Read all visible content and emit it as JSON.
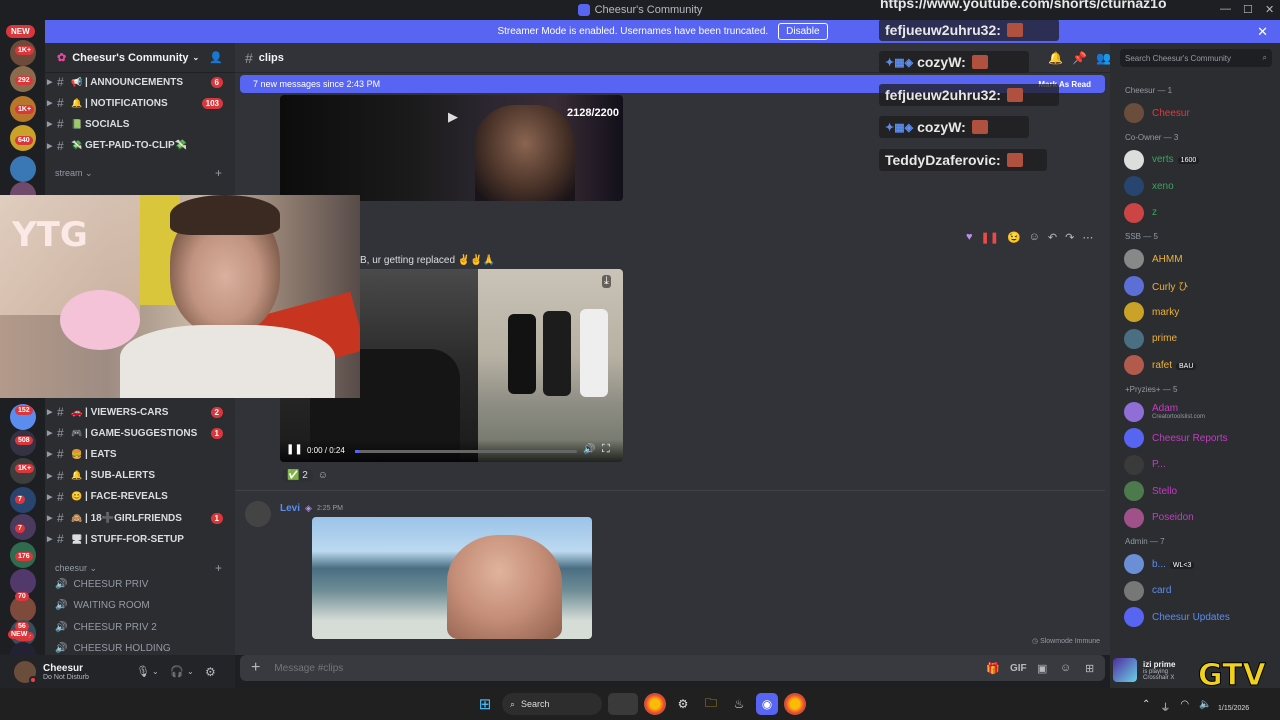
{
  "window": {
    "title": "Cheesur's Community"
  },
  "banner": {
    "text": "Streamer Mode is enabled. Usernames have been truncated.",
    "disable_label": "Disable"
  },
  "rail": {
    "new_label": "NEW",
    "badges": [
      "1K+",
      "292",
      "1K+",
      "640",
      "152",
      "508",
      "1K+",
      "7",
      "7",
      "176",
      "70",
      "56",
      "1K+"
    ]
  },
  "server": {
    "name": "Cheesur's Community"
  },
  "channels_top": [
    {
      "emoji": "📢",
      "name": "| ANNOUNCEMENTS",
      "count": "6"
    },
    {
      "emoji": "🔔",
      "name": "| NOTIFICATIONS",
      "count": "103"
    },
    {
      "emoji": "📗",
      "name": "SOCIALS",
      "count": ""
    },
    {
      "emoji": "💸",
      "name": "GET-PAID-TO-CLIP💸",
      "count": ""
    }
  ],
  "category_stream": "stream",
  "channels_bottom": [
    {
      "emoji": "🚗",
      "name": "| VIEWERS-CARS",
      "count": "2"
    },
    {
      "emoji": "🎮",
      "name": "| GAME-SUGGESTIONS",
      "count": "1"
    },
    {
      "emoji": "🍔",
      "name": "| EATS",
      "count": ""
    },
    {
      "emoji": "🔔",
      "name": "| SUB-ALERTS",
      "count": ""
    },
    {
      "emoji": "😊",
      "name": "| FACE-REVEALS",
      "count": ""
    },
    {
      "emoji": "🙈",
      "name": "| 18➕GIRLFRIENDS",
      "count": "1"
    },
    {
      "emoji": "🖥",
      "name": "| STUFF-FOR-SETUP",
      "count": ""
    }
  ],
  "category_cheesur": "cheesur",
  "voice_channels": [
    "CHEESUR PRIV",
    "WAITING ROOM",
    "CHEESUR PRIV 2",
    "CHEESUR HOLDING"
  ],
  "user": {
    "name": "Cheesur",
    "status": "Do Not Disturb"
  },
  "channel": {
    "name": "clips"
  },
  "new_messages": {
    "text": "7 new messages since 2:43 PM",
    "mark": "Mark As Read"
  },
  "messages": {
    "video1_counter": "2128/2200",
    "msg2_text": "B, ur getting replaced ✌✌🙏",
    "video2_time": "0:00 / 0:24",
    "reaction_count": "2",
    "msg3_author": "Levi",
    "msg3_time": "2:25 PM"
  },
  "composer": {
    "placeholder": "Message #clips",
    "slowmode": "Slowmode Immune"
  },
  "members": {
    "search_placeholder": "Search Cheesur's Community",
    "groups": [
      {
        "title": "Cheesur — 1",
        "people": [
          {
            "name": "Cheesur",
            "color": "#e03a3e",
            "sub": ""
          }
        ]
      },
      {
        "title": "Co-Owner — 3",
        "people": [
          {
            "name": "verts",
            "color": "#3ba55c",
            "sub": "",
            "tag": "1600"
          },
          {
            "name": "xeno",
            "color": "#3ba55c",
            "sub": ""
          },
          {
            "name": "z",
            "color": "#3ba55c",
            "sub": ""
          }
        ]
      },
      {
        "title": "SSB — 5",
        "people": [
          {
            "name": "AHMM",
            "color": "#f0b232",
            "sub": ""
          },
          {
            "name": "Curly ひ",
            "color": "#f0b232",
            "sub": ""
          },
          {
            "name": "marky",
            "color": "#f0b232",
            "sub": ""
          },
          {
            "name": "prime",
            "color": "#f0b232",
            "sub": ""
          },
          {
            "name": "rafet",
            "color": "#f0b232",
            "sub": "",
            "tag": "BAU"
          }
        ]
      },
      {
        "title": "+Pryzies+ — 5",
        "people": [
          {
            "name": "Adam",
            "color": "#c33dc1",
            "sub": "Creatortoolslist.com"
          },
          {
            "name": "Cheesur Reports",
            "color": "#c33dc1",
            "sub": ""
          },
          {
            "name": "P...",
            "color": "#c33dc1",
            "sub": ""
          },
          {
            "name": "Stello",
            "color": "#c33dc1",
            "sub": ""
          },
          {
            "name": "Poseidon",
            "color": "#c33dc1",
            "sub": ""
          }
        ]
      },
      {
        "title": "Admin — 7",
        "people": [
          {
            "name": "b...",
            "color": "#5b8def",
            "sub": "",
            "tag": "WL<3"
          },
          {
            "name": "card",
            "color": "#5b8def",
            "sub": ""
          },
          {
            "name": "Cheesur Updates",
            "color": "#5b8def",
            "sub": ""
          }
        ]
      }
    ],
    "activity": {
      "name": "izi prime",
      "line1": "is playing",
      "line2": "Crosshair X"
    }
  },
  "overlay_chat": {
    "url": "https://www.youtube.com/shorts/cturnaz1o",
    "lines": [
      "fefjueuw2uhru32:",
      "cozyW:",
      "fefjueuw2uhru32:",
      "cozyW:",
      "TeddyDzaferovic:"
    ]
  },
  "taskbar": {
    "search_label": "Search",
    "date": "1/15/2026"
  },
  "colors": {
    "blurple": "#5865f2",
    "red": "#da373c",
    "bg_main": "#313338",
    "bg_side": "#2b2d31"
  }
}
